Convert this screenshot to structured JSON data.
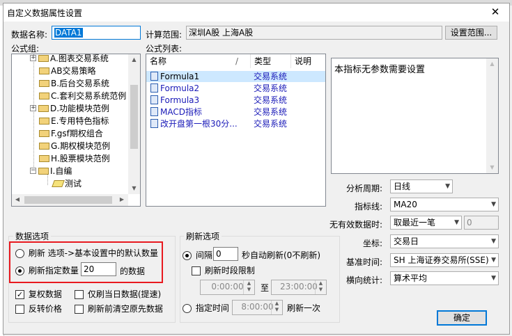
{
  "dialog": {
    "title": "自定义数据属性设置",
    "background_title": "自定义数据管理",
    "close_glyph": "✕",
    "data_name_label": "数据名称:",
    "data_name_value": "DATA1",
    "calc_range_label": "计算范围:",
    "calc_range_value": "深圳A股  上海A股",
    "set_range_button": "设置范围...",
    "formula_group_label": "公式组:",
    "formula_list_label": "公式列表:",
    "ok_button": "确定"
  },
  "tree": {
    "items": [
      {
        "label": "A.图表交易系统",
        "expander": "+"
      },
      {
        "label": "AB交易策略",
        "expander": ""
      },
      {
        "label": "B.后台交易系统",
        "expander": ""
      },
      {
        "label": "C.套利交易系统范例",
        "expander": ""
      },
      {
        "label": "D.功能模块范例",
        "expander": "+"
      },
      {
        "label": "E.专用特色指标",
        "expander": ""
      },
      {
        "label": "F.gsf期权组合",
        "expander": ""
      },
      {
        "label": "G.期权模块范例",
        "expander": ""
      },
      {
        "label": "H.股票模块范例",
        "expander": ""
      },
      {
        "label": "I.自编",
        "expander": "−"
      },
      {
        "label": "测试",
        "expander": ""
      }
    ]
  },
  "formula_list": {
    "columns": [
      "名称",
      "类型",
      "说明"
    ],
    "sort_glyph": "/",
    "rows": [
      {
        "name": "Formula1",
        "type": "交易系统"
      },
      {
        "name": "Formula2",
        "type": "交易系统"
      },
      {
        "name": "Formula3",
        "type": "交易系统"
      },
      {
        "name": "MACD指标",
        "type": "交易系统"
      },
      {
        "name": "改开盘第一根30分...",
        "type": "交易系统"
      }
    ]
  },
  "description": {
    "text": "本指标无参数需要设置"
  },
  "settings": {
    "period_label": "分析周期:",
    "period_value": "日线",
    "indicator_label": "指标线:",
    "indicator_value": "MA20",
    "invalid_label": "无有效数据时:",
    "invalid_value": "取最近一笔",
    "invalid_number": "0",
    "coord_label": "坐标:",
    "coord_value": "交易日",
    "base_time_label": "基准时间:",
    "base_time_value": "SH 上海证券交易所(SSE)",
    "cross_stat_label": "横向统计:",
    "cross_stat_value": "算术平均"
  },
  "data_options": {
    "legend": "数据选项",
    "radio1": "刷新 选项->基本设置中的默认数量",
    "radio2_prefix": "刷新指定数量",
    "radio2_value": "20",
    "radio2_suffix": "的数据",
    "check_adjust": "复权数据",
    "check_today": "仅刷当日数据(提速)",
    "check_reverse": "反转价格",
    "check_clear": "刷新前清空原先数据"
  },
  "refresh_options": {
    "legend": "刷新选项",
    "interval_label": "间隔",
    "interval_value": "0",
    "interval_suffix": "秒自动刷新(0不刷新)",
    "period_limit": "刷新时段限制",
    "time_from": "0:00:00",
    "time_to_label": "至",
    "time_to": "23:00:00",
    "timed_label": "指定时间",
    "timed_value": "8:00:00",
    "timed_suffix": "刷新一次"
  },
  "colors": {
    "selection": "#0078d7",
    "highlight_red": "#e8191f",
    "formula_blue": "#1a1ab8"
  }
}
